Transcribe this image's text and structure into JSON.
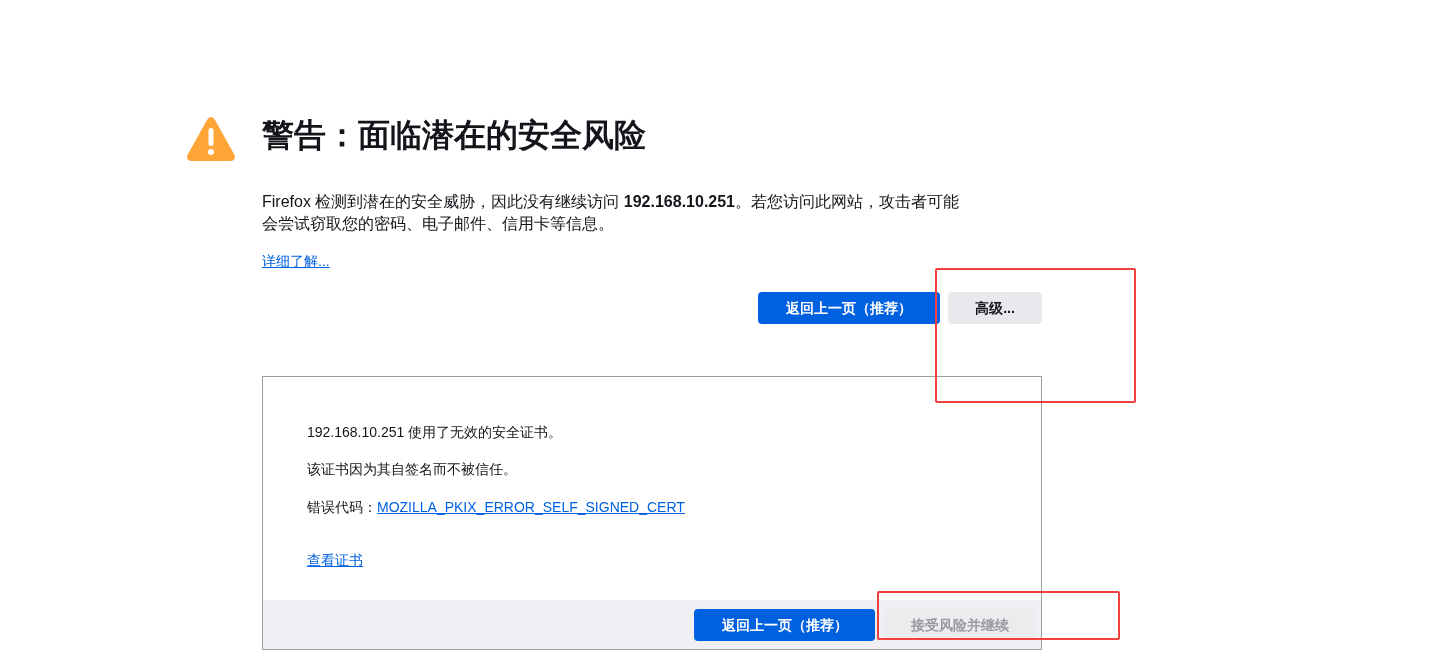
{
  "title": "警告：面临潜在的安全风险",
  "description": "Firefox 检测到潜在的安全威胁，因此没有继续访问 **192.168.10.251**。若您访问此网站，攻击者可能会尝试窃取您的密码、电子邮件、信用卡等信息。",
  "learn_more_link": "详细了解...",
  "buttons": [
    {
      "kind": "primary",
      "label": "返回上一页（推荐）",
      "disabled": false
    },
    {
      "kind": "secondary",
      "label": "高级...",
      "disabled": false
    }
  ],
  "advanced_panel": {
    "lines": [
      "192.168.10.251 使用了无效的安全证书。",
      "该证书因为其自签名而不被信任。"
    ],
    "error_code_label": "错误代码：",
    "error_code": "MOZILLA_PKIX_ERROR_SELF_SIGNED_CERT",
    "view_certificate_link": "查看证书",
    "buttons": [
      {
        "kind": "primary",
        "label": "返回上一页（推荐）",
        "disabled": false
      },
      {
        "kind": "secondary",
        "label": "接受风险并继续",
        "disabled": true
      }
    ]
  }
}
